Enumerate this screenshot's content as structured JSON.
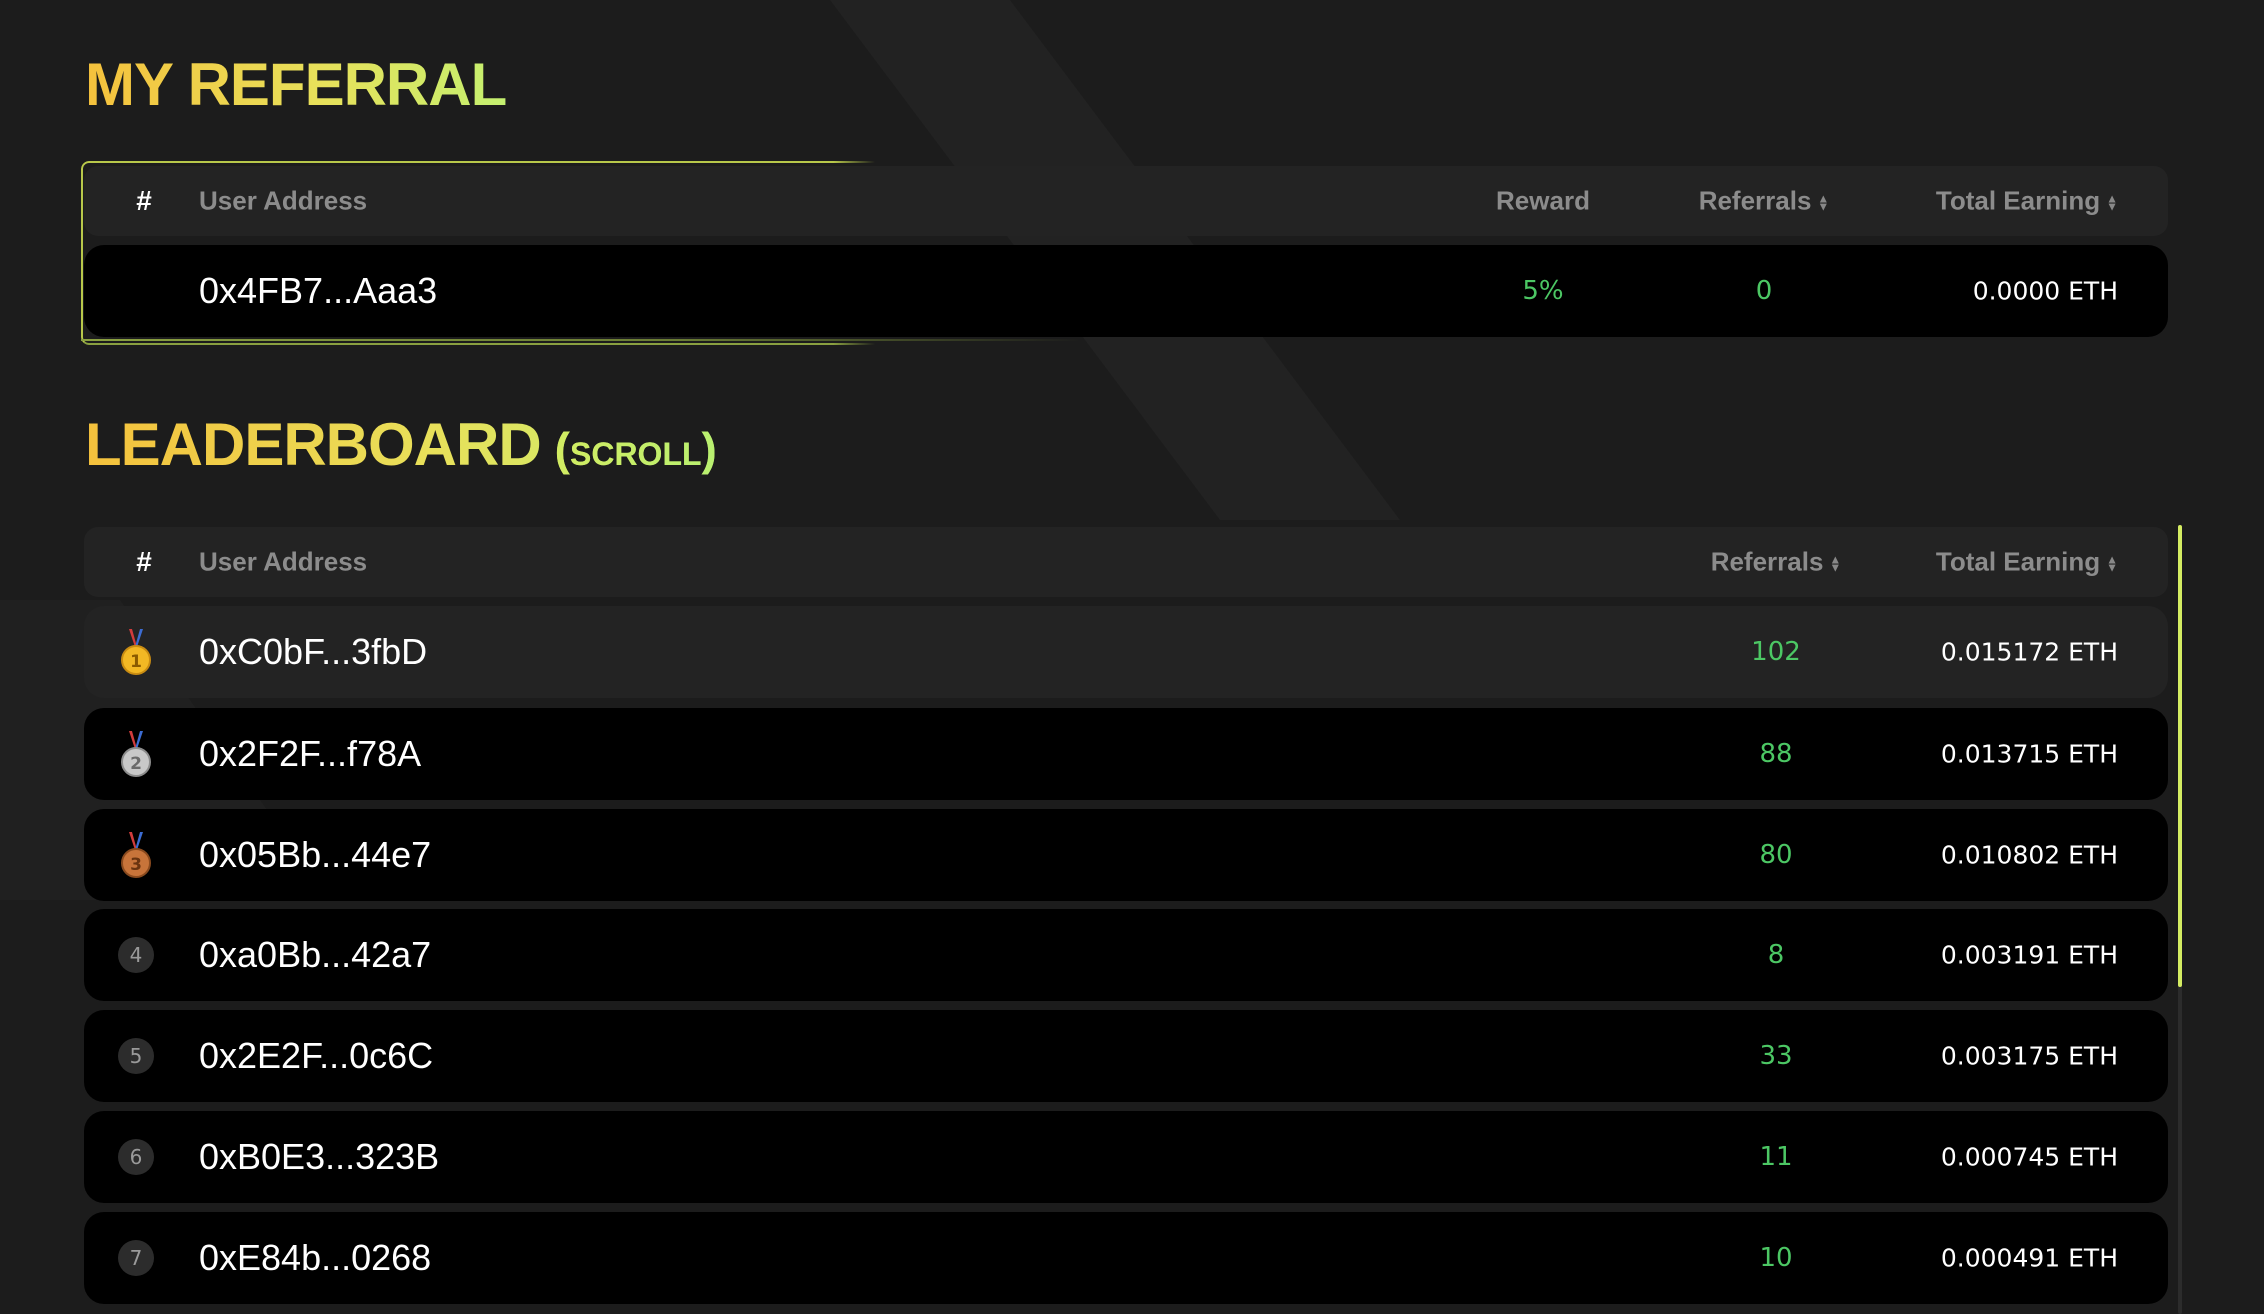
{
  "referral": {
    "title": "MY REFERRAL",
    "headers": {
      "hash": "#",
      "address": "User Address",
      "reward": "Reward",
      "referrals": "Referrals",
      "total": "Total Earning"
    },
    "row": {
      "address": "0x4FB7...Aaa3",
      "reward": "5%",
      "referrals": "0",
      "total": "0.0000 ETH"
    }
  },
  "leaderboard": {
    "title": "LEADERBOARD",
    "scroll_hint": "(scroll)",
    "headers": {
      "hash": "#",
      "address": "User Address",
      "referrals": "Referrals",
      "total": "Total Earning"
    },
    "rows": [
      {
        "rank": "1",
        "rank_icon": "gold-medal-icon",
        "address": "0xC0bF...3fbD",
        "referrals": "102",
        "total": "0.015172 ETH"
      },
      {
        "rank": "2",
        "rank_icon": "silver-medal-icon",
        "address": "0x2F2F...f78A",
        "referrals": "88",
        "total": "0.013715 ETH"
      },
      {
        "rank": "3",
        "rank_icon": "bronze-medal-icon",
        "address": "0x05Bb...44e7",
        "referrals": "80",
        "total": "0.010802 ETH"
      },
      {
        "rank": "4",
        "address": "0xa0Bb...42a7",
        "referrals": "8",
        "total": "0.003191 ETH"
      },
      {
        "rank": "5",
        "address": "0x2E2F...0c6C",
        "referrals": "33",
        "total": "0.003175 ETH"
      },
      {
        "rank": "6",
        "address": "0xB0E3...323B",
        "referrals": "11",
        "total": "0.000745 ETH"
      },
      {
        "rank": "7",
        "address": "0xE84b...0268",
        "referrals": "10",
        "total": "0.000491 ETH"
      }
    ]
  },
  "colors": {
    "background": "#1c1c1c",
    "row": "#000000",
    "header_row": "#232323",
    "accent_green": "#4cc764",
    "title_gold": "#f5c13c",
    "title_lime": "#c4f070",
    "scroll_thumb": "#d4ec62"
  }
}
